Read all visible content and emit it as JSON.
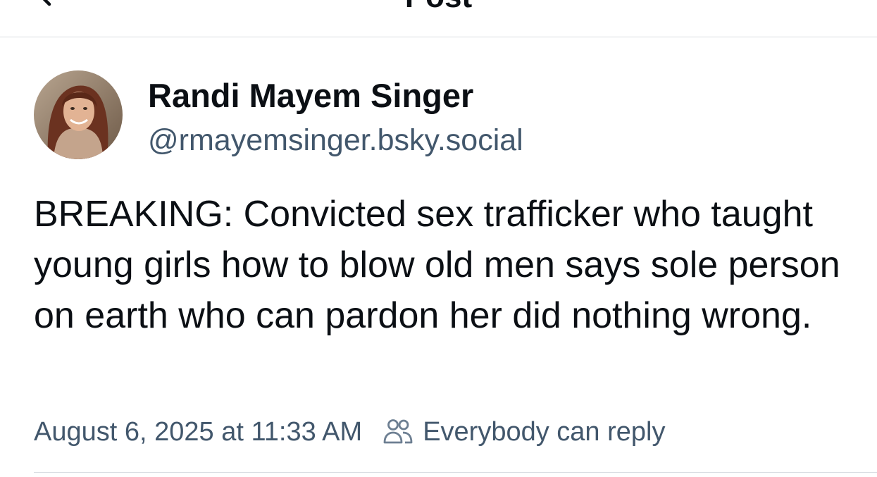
{
  "header": {
    "title": "Post",
    "back_icon": "chevron-left-icon"
  },
  "author": {
    "display_name": "Randi Mayem Singer",
    "handle": "@rmayemsinger.bsky.social"
  },
  "post": {
    "text": "BREAKING: Convicted sex trafficker who taught young girls how to blow old men says sole person on earth who can pardon her did nothing wrong.",
    "timestamp": "August 6, 2025 at 11:33 AM",
    "reply_setting": "Everybody can reply",
    "reply_icon": "people-icon"
  },
  "colors": {
    "text": "#0b0f14",
    "secondary_text": "#42576c",
    "divider": "#d9dde2"
  }
}
